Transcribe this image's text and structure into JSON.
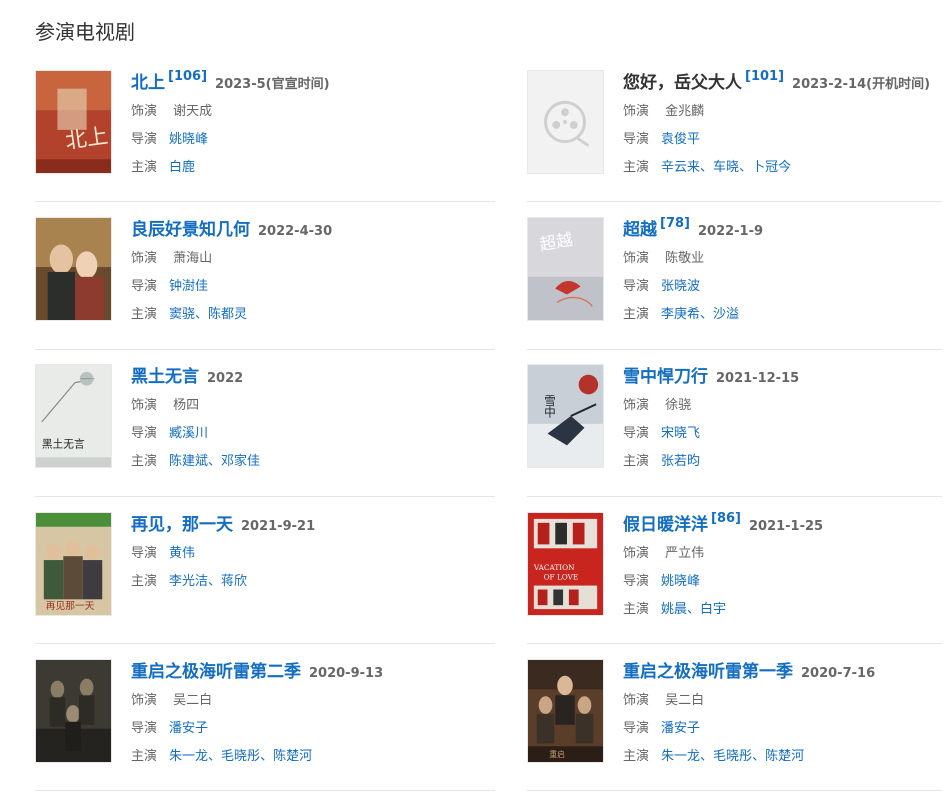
{
  "section_title": "参演电视剧",
  "labels": {
    "role": "饰演",
    "director": "导演",
    "starring": "主演",
    "sep": "、"
  },
  "colors": {
    "link": "#136ec2",
    "text": "#333333",
    "meta": "#666666"
  },
  "dramas": [
    {
      "title": "北上",
      "cite": "[106]",
      "date": "2023-5(官宣时间)",
      "role": "谢天成",
      "directors": [
        "姚晓峰"
      ],
      "starring": [
        "白鹿"
      ],
      "poster_icon": "bei-shang-poster"
    },
    {
      "title": "您好，岳父大人",
      "cite": "[101]",
      "date": "2023-2-14(开机时间)",
      "role": "金兆麟",
      "directors": [
        "袁俊平"
      ],
      "starring": [
        "辛云来",
        "车晓",
        "卜冠今"
      ],
      "poster_icon": "film-reel-placeholder-icon"
    },
    {
      "title": "良辰好景知几何",
      "cite": "",
      "date": "2022-4-30",
      "role": "萧海山",
      "directors": [
        "钟澍佳"
      ],
      "starring": [
        "窦骁",
        "陈都灵"
      ],
      "poster_icon": "couple-poster"
    },
    {
      "title": "超越",
      "cite": "[78]",
      "date": "2022-1-9",
      "role": "陈敬业",
      "directors": [
        "张晓波"
      ],
      "starring": [
        "李庚希",
        "沙溢"
      ],
      "poster_icon": "chaoyue-poster"
    },
    {
      "title": "黑土无言",
      "cite": "",
      "date": "2022",
      "role": "杨四",
      "directors": [
        "臧溪川"
      ],
      "starring": [
        "陈建斌",
        "邓家佳"
      ],
      "poster_icon": "heitu-poster"
    },
    {
      "title": "雪中悍刀行",
      "cite": "",
      "date": "2021-12-15",
      "role": "徐骁",
      "directors": [
        "宋晓飞"
      ],
      "starring": [
        "张若昀"
      ],
      "poster_icon": "xuezhong-poster"
    },
    {
      "title": "再见，那一天",
      "cite": "",
      "date": "2021-9-21",
      "role": "",
      "directors": [
        "黄伟"
      ],
      "starring": [
        "李光洁",
        "蒋欣"
      ],
      "poster_icon": "group-poster"
    },
    {
      "title": "假日暖洋洋",
      "cite": "[86]",
      "date": "2021-1-25",
      "role": "严立伟",
      "directors": [
        "姚晓峰"
      ],
      "starring": [
        "姚晨",
        "白宇"
      ],
      "poster_icon": "vacation-of-love-poster",
      "poster_text": "VACATION OF LOVE"
    },
    {
      "title": "重启之极海听雷第二季",
      "cite": "",
      "date": "2020-9-13",
      "role": "吴二白",
      "directors": [
        "潘安子"
      ],
      "starring": [
        "朱一龙",
        "毛晓彤",
        "陈楚河"
      ],
      "poster_icon": "dark-cast-poster"
    },
    {
      "title": "重启之极海听雷第一季",
      "cite": "",
      "date": "2020-7-16",
      "role": "吴二白",
      "directors": [
        "潘安子"
      ],
      "starring": [
        "朱一龙",
        "毛晓彤",
        "陈楚河"
      ],
      "poster_icon": "cast-poster"
    }
  ]
}
